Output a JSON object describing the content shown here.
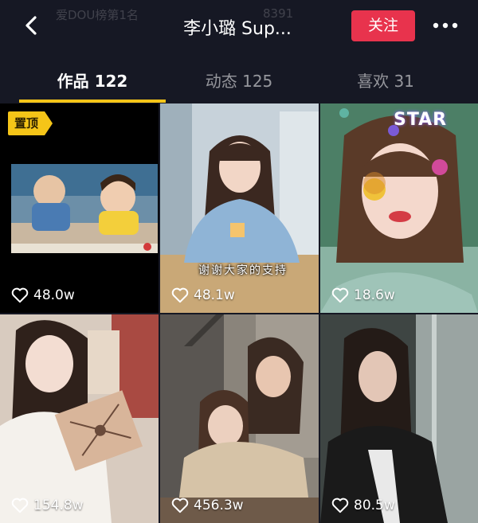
{
  "header": {
    "title": "李小璐 Sup...",
    "faded_left": "爱DOU榜第1名",
    "faded_right": "8391",
    "follow_label": "关注",
    "back_icon": "back-arrow-icon",
    "more_icon": "more-dots-icon"
  },
  "tabs": [
    {
      "label": "作品 122",
      "active": true
    },
    {
      "label": "动态 125",
      "active": false
    },
    {
      "label": "喜欢 31",
      "active": false
    }
  ],
  "colors": {
    "background": "#161824",
    "accent": "#f5c518",
    "follow": "#e8334d"
  },
  "videos": [
    {
      "likes": "48.0w",
      "pinned": true,
      "pin_label": "置顶"
    },
    {
      "likes": "48.1w",
      "caption": "谢谢大家的支持"
    },
    {
      "likes": "18.6w",
      "sticker_text": "STAR"
    },
    {
      "likes": "154.8w"
    },
    {
      "likes": "456.3w"
    },
    {
      "likes": "80.5w"
    }
  ]
}
